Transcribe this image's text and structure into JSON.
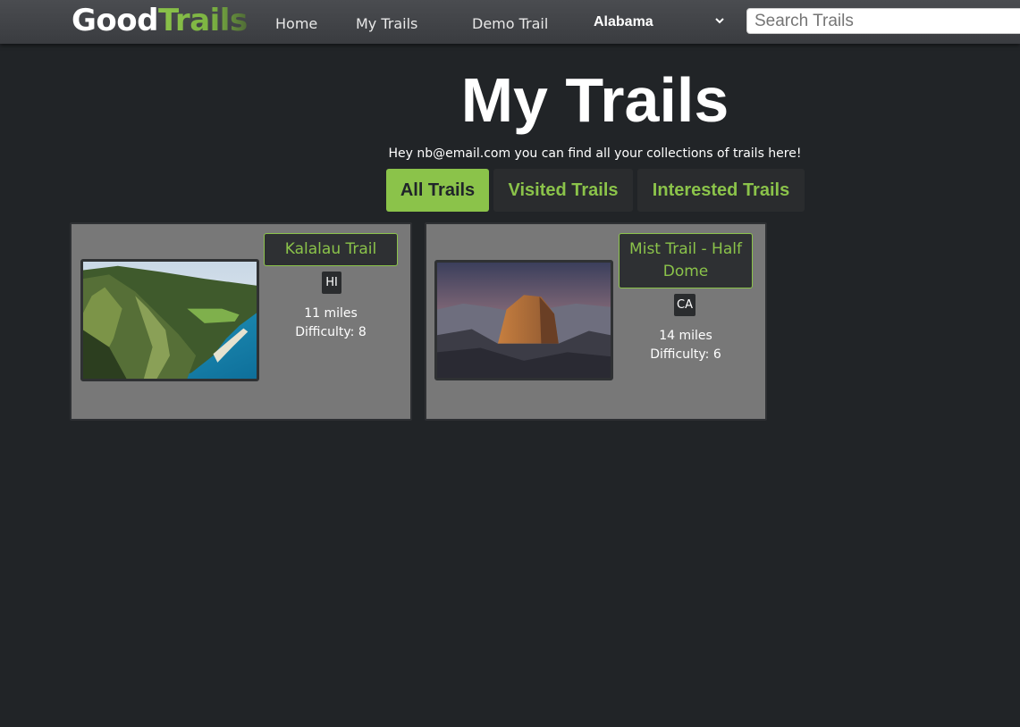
{
  "navbar": {
    "brand_good": "Good",
    "brand_trails": "Trails",
    "links": [
      "Home",
      "My Trails",
      "Demo Trail"
    ],
    "state_selected": "Alabama",
    "search_placeholder": "Search Trails"
  },
  "header": {
    "title": "My Trails",
    "subtitle": "Hey nb@email.com you can find all your collections of trails here!"
  },
  "tabs": [
    {
      "label": "All Trails",
      "active": true
    },
    {
      "label": "Visited Trails",
      "active": false
    },
    {
      "label": "Interested Trails",
      "active": false
    }
  ],
  "cards": [
    {
      "name": "Kalalau Trail",
      "state": "HI",
      "distance": "11 miles",
      "difficulty": "Difficulty: 8"
    },
    {
      "name": "Mist Trail - Half Dome",
      "state": "CA",
      "distance": "14 miles",
      "difficulty": "Difficulty: 6"
    }
  ],
  "colors": {
    "accent": "#8bc34a",
    "background": "#212427",
    "card": "#787878"
  }
}
